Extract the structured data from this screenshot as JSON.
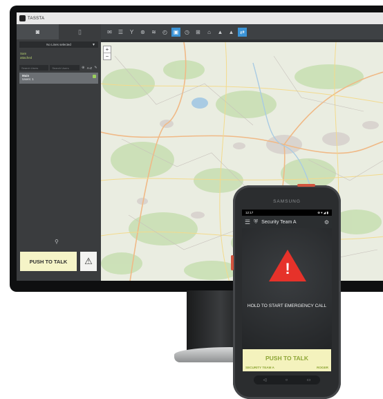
{
  "desktop": {
    "app_name": "TASSTA",
    "sidebar": {
      "tabs": [
        {
          "icon": "headset-icon",
          "glyph": "◙"
        },
        {
          "icon": "walkie-talkie-icon",
          "glyph": "▯"
        }
      ],
      "channel_select": "No Lines selected",
      "status_line_1": "Sam",
      "status_line_2": "attached",
      "search_placeholder_1": "Search Users",
      "search_placeholder_2": "Search Users",
      "sort_label": "A-Z",
      "tree_item_title": "Main",
      "tree_item_sub": "Users: 1",
      "push_to_talk": "PUSH TO TALK",
      "warning_glyph": "⚠"
    },
    "toolbar_icons": [
      "mail-icon",
      "list-icon",
      "signal-icon",
      "gear-icon",
      "dispatch-icon",
      "history-icon",
      "map-icon",
      "clock-icon",
      "grid-icon",
      "home-icon",
      "layers-icon",
      "cloud-icon",
      "route-icon"
    ],
    "toolbar_glyphs": [
      "✉",
      "☰",
      "Y",
      "⊛",
      "≋",
      "◴",
      "▣",
      "◷",
      "⊞",
      "⌂",
      "▲",
      "▲",
      "⇄"
    ],
    "toolbar_active": [
      6,
      12
    ],
    "map": {
      "zoom_in": "+",
      "zoom_out": "−"
    }
  },
  "phone": {
    "brand": "SAMSUNG",
    "status_time": "12:17",
    "status_right": "⊕ ▾ ◢ ▮",
    "header_title": "Security Team A",
    "emergency_text": "HOLD TO START EMERGENCY CALL",
    "ptt_label": "PUSH TO TALK",
    "ptt_group": "SECURITY TEAM A",
    "ptt_user": "ROGER",
    "nav_glyphs": [
      "◁",
      "○",
      "▭"
    ]
  },
  "colors": {
    "ptt_bg": "#f5f4c7",
    "emergency_red": "#e6322a",
    "accent_blue": "#3b93d6",
    "ptt_text_green": "#8ea636"
  }
}
